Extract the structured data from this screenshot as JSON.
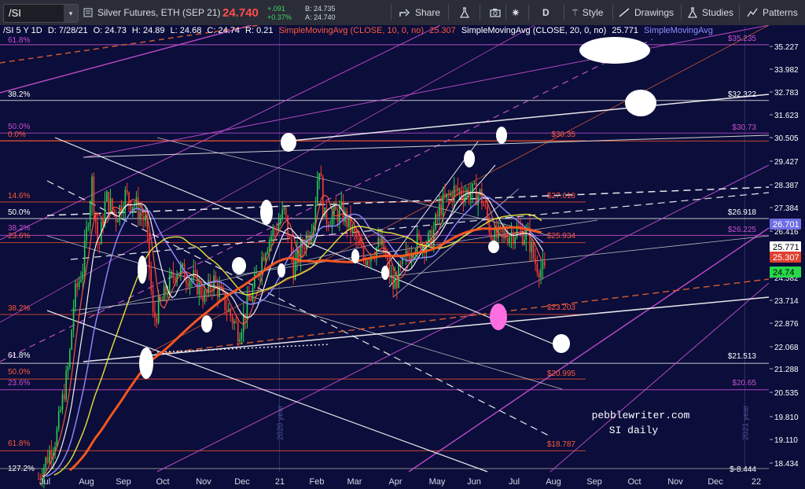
{
  "toolbar": {
    "symbol": "/SI",
    "dropdown_glyph": "▾",
    "description": "Silver Futures, ETH (SEP 21)",
    "last": "24.740",
    "change_abs": "+.091",
    "change_pct": "+0.37%",
    "bid": "B: 24.735",
    "ask": "A: 24.740",
    "share": "Share",
    "interval": "D",
    "style": "Style",
    "drawings": "Drawings",
    "studies": "Studies",
    "patterns": "Patterns",
    "colors": {
      "last": "#ff4d4d",
      "change": "#3fd46a",
      "background": "#2a2d37"
    }
  },
  "info_bar": {
    "symbol": "/SI 5 Y 1D",
    "date": "D: 7/28/21",
    "open": "O: 24.73",
    "high": "H: 24.89",
    "low": "L: 24.68",
    "close": "C: 24.74",
    "range": "R: 0.21",
    "sma10": "SimpleMovingAvg (CLOSE, 10, 0, no)",
    "sma10_value": "25.307",
    "sma20": "SimpleMovingAvg (CLOSE, 20, 0, no)",
    "sma20_value": "25.771",
    "sma_cut": "SimpleMovingAvg"
  },
  "price_axis": [
    "35.227",
    "33.982",
    "32.783",
    "31.623",
    "30.505",
    "29.427",
    "28.387",
    "27.384",
    "26.416",
    "25.482",
    "24.582",
    "23.714",
    "22.876",
    "22.068",
    "21.288",
    "20.535",
    "19.810",
    "19.110",
    "18.434"
  ],
  "price_tags": [
    {
      "label": "26.701",
      "color": "#6f6ee6",
      "text_color": "#ffffff"
    },
    {
      "label": "25.771",
      "color": "#ffffff",
      "text_color": "#000000"
    },
    {
      "label": "25.307",
      "color": "#e0402f",
      "text_color": "#ffffff"
    },
    {
      "label": "24.74",
      "color": "#28d84a",
      "text_color": "#000000"
    }
  ],
  "time_axis": [
    "Jul",
    "Aug",
    "Sep",
    "Oct",
    "Nov",
    "Dec",
    "21",
    "Feb",
    "Mar",
    "Apr",
    "May",
    "Jun",
    "Jul",
    "Aug",
    "Sep",
    "Oct",
    "Nov",
    "Dec",
    "22"
  ],
  "year_labels": [
    "2020 year",
    "2021 year"
  ],
  "fib_left": [
    "61.8%",
    "38.2%",
    "50.0%",
    "0.0%",
    "14.6%",
    "50.0%",
    "38.2%",
    "23.6%",
    "38.2%",
    "61.8%",
    "50.0%",
    "23.6%",
    "61.8%",
    "127.2%"
  ],
  "level_labels": [
    "$35.235",
    "$32.322",
    "$30.73",
    "$30.35",
    "$27.618",
    "$26.918",
    "$26.225",
    "$25.934",
    "$23.203",
    "$21.513",
    "$20.995",
    "$20.65",
    "$18.787",
    "$-8.444"
  ],
  "watermark": {
    "line1": "pebblewriter.com",
    "line2": "SI daily"
  },
  "chart_data": {
    "type": "candlestick",
    "title": "/SI 5 Y 1D",
    "ylim": [
      18.2,
      36.0
    ],
    "y_scale": "log",
    "series": [
      {
        "name": "SimpleMovingAvg (CLOSE, 10, 0, no)",
        "last": 25.307
      },
      {
        "name": "SimpleMovingAvg (CLOSE, 20, 0, no)",
        "last": 25.771
      }
    ],
    "close_points": [
      {
        "x": "2020-06-26",
        "y": 18.0
      },
      {
        "x": "2020-07-10",
        "y": 19.2
      },
      {
        "x": "2020-07-20",
        "y": 21.5
      },
      {
        "x": "2020-07-24",
        "y": 23.8
      },
      {
        "x": "2020-07-31",
        "y": 25.0
      },
      {
        "x": "2020-08-07",
        "y": 28.5
      },
      {
        "x": "2020-08-12",
        "y": 25.6
      },
      {
        "x": "2020-08-18",
        "y": 27.8
      },
      {
        "x": "2020-08-26",
        "y": 27.0
      },
      {
        "x": "2020-09-02",
        "y": 27.9
      },
      {
        "x": "2020-09-10",
        "y": 27.5
      },
      {
        "x": "2020-09-18",
        "y": 26.8
      },
      {
        "x": "2020-09-24",
        "y": 23.0
      },
      {
        "x": "2020-10-02",
        "y": 23.8
      },
      {
        "x": "2020-10-12",
        "y": 24.9
      },
      {
        "x": "2020-10-26",
        "y": 24.5
      },
      {
        "x": "2020-11-04",
        "y": 23.8
      },
      {
        "x": "2020-11-10",
        "y": 24.5
      },
      {
        "x": "2020-11-20",
        "y": 23.5
      },
      {
        "x": "2020-11-30",
        "y": 22.6
      },
      {
        "x": "2020-12-10",
        "y": 23.9
      },
      {
        "x": "2020-12-21",
        "y": 25.8
      },
      {
        "x": "2021-01-05",
        "y": 27.2
      },
      {
        "x": "2021-01-12",
        "y": 24.9
      },
      {
        "x": "2021-01-28",
        "y": 26.9
      },
      {
        "x": "2021-02-01",
        "y": 29.4
      },
      {
        "x": "2021-02-05",
        "y": 26.9
      },
      {
        "x": "2021-02-19",
        "y": 27.2
      },
      {
        "x": "2021-03-01",
        "y": 26.2
      },
      {
        "x": "2021-03-08",
        "y": 25.3
      },
      {
        "x": "2021-03-22",
        "y": 25.9
      },
      {
        "x": "2021-03-31",
        "y": 24.2
      },
      {
        "x": "2021-04-16",
        "y": 25.9
      },
      {
        "x": "2021-04-30",
        "y": 26.0
      },
      {
        "x": "2021-05-07",
        "y": 27.4
      },
      {
        "x": "2021-05-18",
        "y": 28.1
      },
      {
        "x": "2021-06-01",
        "y": 28.0
      },
      {
        "x": "2021-06-08",
        "y": 27.9
      },
      {
        "x": "2021-06-17",
        "y": 26.1
      },
      {
        "x": "2021-06-25",
        "y": 26.2
      },
      {
        "x": "2021-07-06",
        "y": 26.4
      },
      {
        "x": "2021-07-15",
        "y": 26.2
      },
      {
        "x": "2021-07-20",
        "y": 25.2
      },
      {
        "x": "2021-07-28",
        "y": 24.74
      }
    ]
  }
}
